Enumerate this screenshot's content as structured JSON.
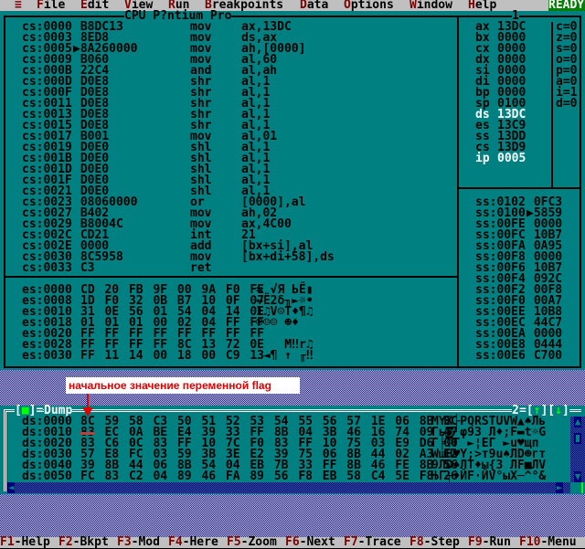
{
  "menu": {
    "items": [
      {
        "hot": "≡",
        "rest": ""
      },
      {
        "hot": "F",
        "rest": "ile"
      },
      {
        "hot": "E",
        "rest": "dit"
      },
      {
        "hot": "V",
        "rest": "iew"
      },
      {
        "hot": "R",
        "rest": "un"
      },
      {
        "hot": "B",
        "rest": "reakpoints"
      },
      {
        "hot": "D",
        "rest": "ata"
      },
      {
        "hot": "O",
        "rest": "ptions"
      },
      {
        "hot": "W",
        "rest": "indow"
      },
      {
        "hot": "H",
        "rest": "elp"
      }
    ],
    "status": "READY"
  },
  "cpu": {
    "title": "CPU P?ntium Pro",
    "window_number": "1",
    "code": [
      [
        "cs:0000",
        " B8DC13",
        "mov",
        "ax,13DC"
      ],
      [
        "cs:0003",
        " 8ED8",
        "mov",
        "ds,ax"
      ],
      [
        "cs:0005",
        "▶8A260000",
        "mov",
        "ah,[0000]"
      ],
      [
        "cs:0009",
        " B060",
        "mov",
        "al,60"
      ],
      [
        "cs:000B",
        " 22C4",
        "and",
        "al,ah"
      ],
      [
        "cs:000D",
        " D0E8",
        "shr",
        "al,1"
      ],
      [
        "cs:000F",
        " D0E8",
        "shr",
        "al,1"
      ],
      [
        "cs:0011",
        " D0E8",
        "shr",
        "al,1"
      ],
      [
        "cs:0013",
        " D0E8",
        "shr",
        "al,1"
      ],
      [
        "cs:0015",
        " D0E8",
        "shr",
        "al,1"
      ],
      [
        "cs:0017",
        " B001",
        "mov",
        "al,01"
      ],
      [
        "cs:0019",
        " D0E0",
        "shl",
        "al,1"
      ],
      [
        "cs:001B",
        " D0E0",
        "shl",
        "al,1"
      ],
      [
        "cs:001D",
        " D0E0",
        "shl",
        "al,1"
      ],
      [
        "cs:001F",
        " D0E0",
        "shl",
        "al,1"
      ],
      [
        "cs:0021",
        " D0E0",
        "shl",
        "al,1"
      ],
      [
        "cs:0023",
        " 08060000",
        "or",
        "[0000],al"
      ],
      [
        "cs:0027",
        " B402",
        "mov",
        "ah,02"
      ],
      [
        "cs:0029",
        " B8004C",
        "mov",
        "ax,4C00"
      ],
      [
        "cs:002C",
        " CD21",
        "int",
        "21"
      ],
      [
        "cs:002E",
        " 0000",
        "add",
        "[bx+si],al"
      ],
      [
        "cs:0030",
        " 8C5958",
        "mov",
        "[bx+di+58],ds"
      ],
      [
        "cs:0033",
        " C3",
        "ret",
        ""
      ]
    ],
    "registers": [
      [
        "ax",
        "13DC"
      ],
      [
        "bx",
        "0000"
      ],
      [
        "cx",
        "0000"
      ],
      [
        "dx",
        "0000"
      ],
      [
        "si",
        "0000"
      ],
      [
        "di",
        "0000"
      ],
      [
        "bp",
        "0000"
      ],
      [
        "sp",
        "0100"
      ],
      [
        "ds",
        "13DC"
      ],
      [
        "es",
        "13C9"
      ],
      [
        "ss",
        "13DD"
      ],
      [
        "cs",
        "13D9"
      ],
      [
        "ip",
        "0005"
      ]
    ],
    "changed_registers": [
      "ds",
      "ip"
    ],
    "flags": [
      "c=0",
      "z=0",
      "s=0",
      "o=0",
      "p=0",
      "a=0",
      "i=1",
      "d=0"
    ],
    "stack": [
      [
        "ss:0102",
        " 0FC3"
      ],
      [
        "ss:0100",
        "▶5859"
      ],
      [
        "ss:00FE",
        " 0000"
      ],
      [
        "ss:00FC",
        " 10B7"
      ],
      [
        "ss:00FA",
        " 0A95"
      ],
      [
        "ss:00F8",
        " 0000"
      ],
      [
        "ss:00F6",
        " 10B7"
      ],
      [
        "ss:00F4",
        " 092C"
      ],
      [
        "ss:00F2",
        " 00F8"
      ],
      [
        "ss:00F0",
        " 00A7"
      ],
      [
        "ss:00EE",
        " 10B8"
      ],
      [
        "ss:00EC",
        " 44C7"
      ],
      [
        "ss:00EA",
        " 0000"
      ],
      [
        "ss:00E8",
        " 0444"
      ],
      [
        "ss:00E6",
        " C700"
      ]
    ],
    "data": [
      [
        "es:0000",
        "CD 20 FB 9F 00 9A F0 FE",
        "= √Я ЬЁ▮"
      ],
      [
        "es:0008",
        "1D F0 32 0B B7 10 0F 07",
        "↔Ё2δ╖►☼•"
      ],
      [
        "es:0010",
        "31 0E 56 01 54 04 14 0E",
        "1♫V☺T♦¶♫"
      ],
      [
        "es:0018",
        "01 01 01 00 02 04 FF FF",
        "☺☺☺ ☻♦"
      ],
      [
        "es:0020",
        "FF FF FF FF FF FF FF FF",
        ""
      ],
      [
        "es:0028",
        "FF FF FF FF 8C 13 72 0E",
        "    M‼r♫"
      ],
      [
        "es:0030",
        "FF 11 14 00 18 00 C9 13",
        " ◄¶ ↑ ╓‼"
      ]
    ]
  },
  "dump": {
    "title": "Dump",
    "close": "■",
    "window_number": "2",
    "up": "↑",
    "down": "↓",
    "rows": [
      [
        "ds:0000",
        "8C 59 58 C3 50 51 52 53 54 55 56 57 1E 06 8B EC",
        "MYX├PQRSTUVW▲♠Ль"
      ],
      [
        "ds:0010",
        "83 EC 0A BE E4 39 33 FF 8B 04 3B 46 16 74 09 47",
        "Гь◙┘φ93 Л♦;F▬t☼G"
      ],
      [
        "ds:0020",
        "83 C6 0C 83 FF 10 7C F0 83 FF 10 75 03 E9 D6 00",
        "Г╞♀Г ►¦ЕГ ►u♥щп"
      ],
      [
        "ds:0030",
        "57 E8 FC 03 59 3B 3E E2 39 75 06 8B 44 02 A3 E2",
        "WшН♥Y;>т9u♠ЛD☻гт"
      ],
      [
        "ds:0040",
        "39 8B 44 06 8B 54 04 EB 7B 33 FF 8B 46 FE 8B 56",
        "9ЛD♠ЛТ♦ы{3 ЛF■ЛV"
      ],
      [
        "ds:0050",
        "FC 83 C2 04 89 46 FA 89 56 F8 EB 58 C4 5E F8 26",
        "ЊГ┬♦ЙF·ЙV°ыX─^°&"
      ]
    ]
  },
  "annotation": "начальное значение переменной flag",
  "fkeys": [
    [
      "F1",
      "-Help"
    ],
    [
      "F2",
      "-Bkpt"
    ],
    [
      "F3",
      "-Mod"
    ],
    [
      "F4",
      "-Here"
    ],
    [
      "F5",
      "-Zoom"
    ],
    [
      "F6",
      "-Next"
    ],
    [
      "F7",
      "-Trace"
    ],
    [
      "F8",
      "-Step"
    ],
    [
      "F9",
      "-Run"
    ],
    [
      "F10",
      "-Menu"
    ]
  ],
  "colors": {
    "window": "#008080",
    "menu": "#c0c0c0",
    "hotkey": "#800000",
    "ready": "#008000",
    "annotation": "#e00000"
  }
}
